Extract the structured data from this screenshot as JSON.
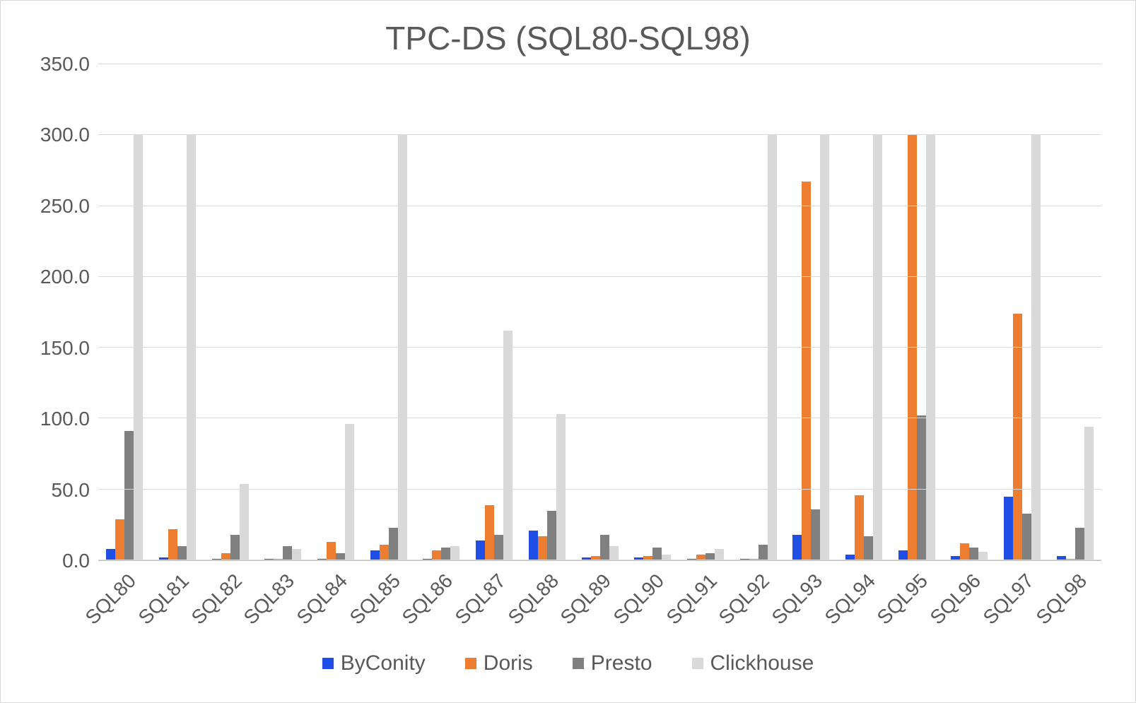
{
  "chart_data": {
    "type": "bar",
    "title": "TPC-DS (SQL80-SQL98)",
    "xlabel": "",
    "ylabel": "",
    "ylim": [
      0,
      350
    ],
    "ytick_step": 50,
    "yticks": [
      "0.0",
      "50.0",
      "100.0",
      "150.0",
      "200.0",
      "250.0",
      "300.0",
      "350.0"
    ],
    "categories": [
      "SQL80",
      "SQL81",
      "SQL82",
      "SQL83",
      "SQL84",
      "SQL85",
      "SQL86",
      "SQL87",
      "SQL88",
      "SQL89",
      "SQL90",
      "SQL91",
      "SQL92",
      "SQL93",
      "SQL94",
      "SQL95",
      "SQL96",
      "SQL97",
      "SQL98"
    ],
    "series": [
      {
        "name": "ByConity",
        "color": "#1F4EE4",
        "values": [
          8,
          2,
          1,
          1,
          1,
          7,
          1,
          14,
          21,
          2,
          2,
          1,
          1,
          18,
          4,
          7,
          3,
          45,
          3
        ]
      },
      {
        "name": "Doris",
        "color": "#ED7D31",
        "values": [
          29,
          22,
          5,
          1,
          13,
          11,
          7,
          39,
          17,
          3,
          3,
          4,
          1,
          267,
          46,
          300,
          12,
          174,
          1
        ]
      },
      {
        "name": "Presto",
        "color": "#808080",
        "values": [
          91,
          10,
          18,
          10,
          5,
          23,
          9,
          18,
          35,
          18,
          9,
          5,
          11,
          36,
          17,
          102,
          9,
          33,
          23
        ]
      },
      {
        "name": "Clickhouse",
        "color": "#D9D9D9",
        "values": [
          300,
          300,
          54,
          8,
          96,
          300,
          10,
          162,
          103,
          10,
          4,
          8,
          300,
          300,
          300,
          300,
          6,
          300,
          94
        ]
      }
    ],
    "legend_position": "bottom"
  }
}
